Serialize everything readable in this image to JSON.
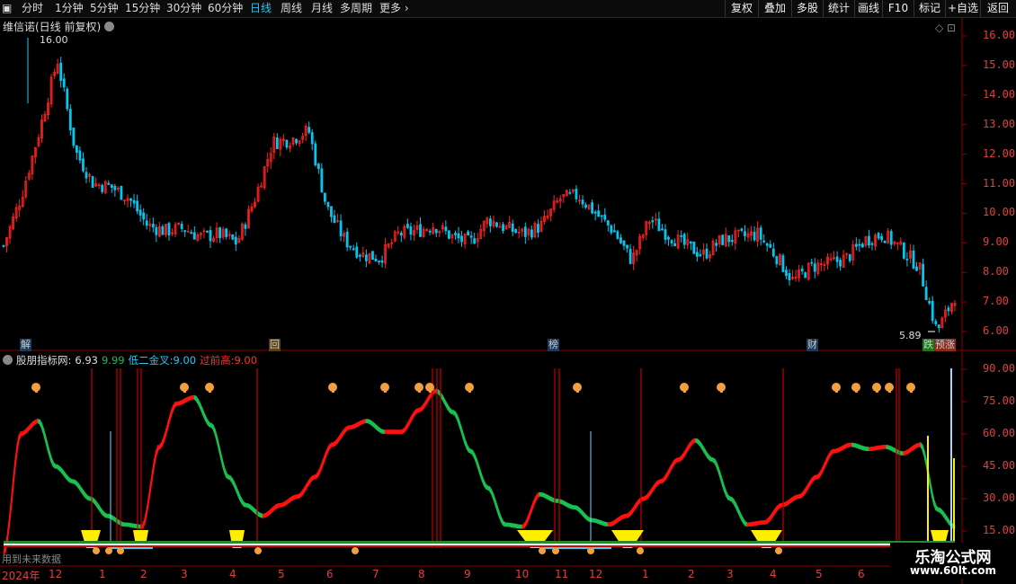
{
  "toolbar": {
    "periods": [
      "分时",
      "1分钟",
      "5分钟",
      "15分钟",
      "30分钟",
      "60分钟",
      "日线",
      "周线",
      "月线",
      "多周期",
      "更多"
    ],
    "active_period": "日线",
    "more_arrow": "›",
    "buttons": [
      "复权",
      "叠加",
      "多股",
      "统计",
      "画线",
      "F10",
      "标记",
      "+自选",
      "返回"
    ]
  },
  "main": {
    "title": "维信诺(日线 前复权)",
    "max_label": "16.00",
    "min_label": "5.89",
    "y_ticks": [
      "16.00",
      "15.00",
      "14.00",
      "13.00",
      "12.00",
      "11.00",
      "10.00",
      "9.00",
      "8.00",
      "7.00",
      "6.00"
    ],
    "event_tags": [
      {
        "text": "解",
        "color": "#29c5f6"
      },
      {
        "text": "回",
        "color": "#f0c040"
      },
      {
        "text": "榜",
        "color": "#29c5f6"
      },
      {
        "text": "财",
        "color": "#29c5f6"
      },
      {
        "text": "跌",
        "color": "#ffffff"
      },
      {
        "text": "预涨",
        "color": "#ffffff"
      }
    ]
  },
  "indicator": {
    "name": "股朋指标网",
    "sep": ":",
    "v1": "6.93",
    "v2": "9.99",
    "label3": "低二金叉:",
    "v3": "9.00",
    "label4": "过前高:",
    "v4": "9.00",
    "y_ticks": [
      "90.00",
      "75.00",
      "60.00",
      "45.00",
      "30.00",
      "15.00"
    ],
    "future_note": "用到未来数据"
  },
  "x_axis": [
    "2024年",
    "12",
    "1",
    "2",
    "3",
    "4",
    "5",
    "6",
    "7",
    "8",
    "9",
    "10",
    "11",
    "12",
    "1",
    "2",
    "3",
    "4",
    "5",
    "6"
  ],
  "watermark": {
    "name": "乐淘公式网",
    "url": "www.60lt.com"
  },
  "colors": {
    "up": "#ff2020",
    "down": "#00c8f0",
    "rise": "#ff1010",
    "fall": "#18c050",
    "grid": "#8b0000",
    "yellow": "#ffee00"
  },
  "chart_data": {
    "type": "candlestick",
    "price_range": [
      5.89,
      16.0
    ],
    "close_trend": [
      8.9,
      10.6,
      12.8,
      15.2,
      12.1,
      11.0,
      10.9,
      10.5,
      9.6,
      9.4,
      9.5,
      9.2,
      9.3,
      9.0,
      10.5,
      12.4,
      12.5,
      12.8,
      10.2,
      9.1,
      8.6,
      8.5,
      9.3,
      9.4,
      9.6,
      9.2,
      9.0,
      9.8,
      9.5,
      9.3,
      9.6,
      10.5,
      10.6,
      10.0,
      9.4,
      8.4,
      9.8,
      9.3,
      8.9,
      8.6,
      9.1,
      9.2,
      9.3,
      8.6,
      7.7,
      8.2,
      8.3,
      8.5,
      9.1,
      9.3,
      8.8,
      8.2,
      6.0,
      7.2
    ],
    "indicator_range": [
      0,
      95
    ],
    "indicator_line": [
      5,
      60,
      66,
      45,
      38,
      30,
      22,
      18,
      17,
      54,
      74,
      77,
      64,
      40,
      27,
      22,
      27,
      31,
      40,
      55,
      63,
      66,
      61,
      61,
      71,
      80,
      70,
      52,
      35,
      18,
      17,
      32,
      29,
      26,
      20,
      18,
      22,
      30,
      38,
      48,
      57,
      48,
      30,
      18,
      19,
      27,
      31,
      40,
      52,
      55,
      53,
      54,
      51,
      55,
      25,
      17
    ]
  }
}
